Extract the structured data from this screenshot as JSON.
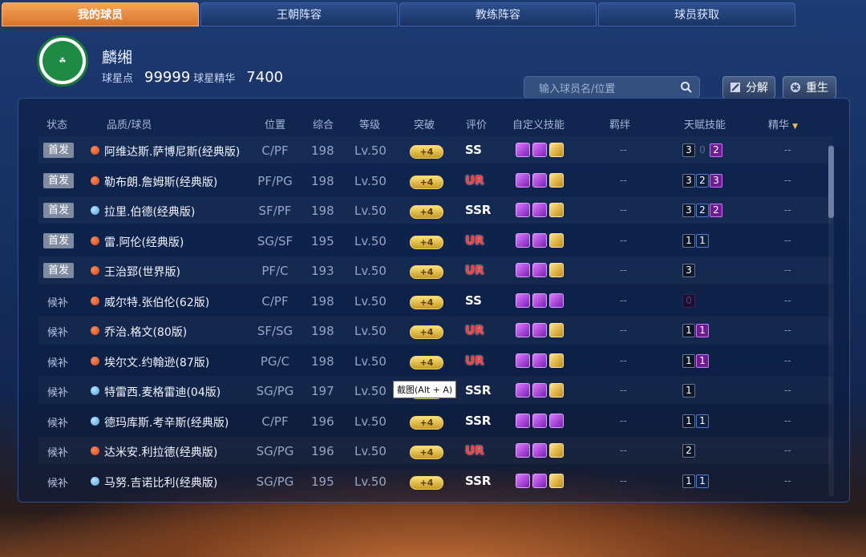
{
  "tabs": [
    {
      "label": "我的球员",
      "active": true
    },
    {
      "label": "王朝阵容",
      "active": false
    },
    {
      "label": "教练阵容",
      "active": false
    },
    {
      "label": "球员获取",
      "active": false
    }
  ],
  "team": {
    "name": "麟缃",
    "points_label": "球星点",
    "points_value": "99999",
    "essence_label": "球星精华",
    "essence_value": "7400",
    "logo_text": "BOSTON CELTICS"
  },
  "search": {
    "placeholder": "输入球员名/位置"
  },
  "toolbar": {
    "decompose_label": "分解",
    "rebirth_label": "重生"
  },
  "columns": [
    "状态",
    "品质/球员",
    "位置",
    "综合",
    "等级",
    "突破",
    "评价",
    "自定义技能",
    "羁绊",
    "天赋技能",
    "精华"
  ],
  "breakthrough_label": "+4",
  "empty_value": "--",
  "players": [
    {
      "status": "首发",
      "starter": true,
      "quality": "red",
      "name": "阿维达斯.萨博尼斯(经典版)",
      "position": "C/PF",
      "overall": "198",
      "level": "Lv.50",
      "rating": "SS",
      "skills": [
        "p",
        "p",
        "g"
      ],
      "talents": [
        [
          "3",
          "k"
        ],
        [
          "0",
          "n"
        ],
        [
          "2",
          "p"
        ]
      ]
    },
    {
      "status": "首发",
      "starter": true,
      "quality": "red",
      "name": "勒布朗.詹姆斯(经典版)",
      "position": "PF/PG",
      "overall": "198",
      "level": "Lv.50",
      "rating": "UR",
      "skills": [
        "p",
        "p",
        "g"
      ],
      "talents": [
        [
          "3",
          "k"
        ],
        [
          "2",
          "b"
        ],
        [
          "3",
          "p"
        ]
      ]
    },
    {
      "status": "首发",
      "starter": true,
      "quality": "blue",
      "name": "拉里.伯德(经典版)",
      "position": "SF/PF",
      "overall": "198",
      "level": "Lv.50",
      "rating": "SSR",
      "skills": [
        "p",
        "p",
        "g"
      ],
      "talents": [
        [
          "3",
          "k"
        ],
        [
          "2",
          "b"
        ],
        [
          "2",
          "p"
        ]
      ]
    },
    {
      "status": "首发",
      "starter": true,
      "quality": "red",
      "name": "雷.阿伦(经典版)",
      "position": "SG/SF",
      "overall": "195",
      "level": "Lv.50",
      "rating": "UR",
      "skills": [
        "p",
        "p",
        "g"
      ],
      "talents": [
        [
          "1",
          "k"
        ],
        [
          "1",
          "b"
        ]
      ]
    },
    {
      "status": "首发",
      "starter": true,
      "quality": "red",
      "name": "王治郅(世界版)",
      "position": "PF/C",
      "overall": "193",
      "level": "Lv.50",
      "rating": "UR",
      "skills": [
        "p",
        "p",
        "g"
      ],
      "talents": [
        [
          "3",
          "k"
        ]
      ]
    },
    {
      "status": "候补",
      "starter": false,
      "quality": "red",
      "name": "威尔特.张伯伦(62版)",
      "position": "C/PF",
      "overall": "198",
      "level": "Lv.50",
      "rating": "SS",
      "skills": [
        "p",
        "p",
        "p"
      ],
      "talents": [
        [
          "0",
          "z"
        ]
      ]
    },
    {
      "status": "候补",
      "starter": false,
      "quality": "red",
      "name": "乔治.格文(80版)",
      "position": "SF/SG",
      "overall": "198",
      "level": "Lv.50",
      "rating": "UR",
      "skills": [
        "p",
        "p",
        "g"
      ],
      "talents": [
        [
          "1",
          "k"
        ],
        [
          "1",
          "p"
        ]
      ]
    },
    {
      "status": "候补",
      "starter": false,
      "quality": "red",
      "name": "埃尔文.约翰逊(87版)",
      "position": "PG/C",
      "overall": "198",
      "level": "Lv.50",
      "rating": "UR",
      "skills": [
        "p",
        "p",
        "g"
      ],
      "talents": [
        [
          "1",
          "k"
        ],
        [
          "1",
          "p"
        ]
      ]
    },
    {
      "status": "候补",
      "starter": false,
      "quality": "blue",
      "name": "特雷西.麦格雷迪(04版)",
      "position": "SG/PG",
      "overall": "197",
      "level": "Lv.50",
      "rating": "SSR",
      "skills": [
        "p",
        "p",
        "g"
      ],
      "talents": [
        [
          "1",
          "k"
        ]
      ]
    },
    {
      "status": "候补",
      "starter": false,
      "quality": "blue",
      "name": "德玛库斯.考辛斯(经典版)",
      "position": "C/PF",
      "overall": "196",
      "level": "Lv.50",
      "rating": "SSR",
      "skills": [
        "p",
        "p",
        "p"
      ],
      "talents": [
        [
          "1",
          "k"
        ],
        [
          "1",
          "b"
        ]
      ]
    },
    {
      "status": "候补",
      "starter": false,
      "quality": "red",
      "name": "达米安.利拉德(经典版)",
      "position": "SG/PG",
      "overall": "196",
      "level": "Lv.50",
      "rating": "UR",
      "skills": [
        "p",
        "p",
        "g"
      ],
      "talents": [
        [
          "2",
          "k"
        ]
      ]
    },
    {
      "status": "候补",
      "starter": false,
      "quality": "blue",
      "name": "马努.吉诺比利(经典版)",
      "position": "SG/PG",
      "overall": "195",
      "level": "Lv.50",
      "rating": "SSR",
      "skills": [
        "p",
        "p",
        "g"
      ],
      "talents": [
        [
          "1",
          "k"
        ],
        [
          "1",
          "b"
        ]
      ]
    }
  ],
  "tooltip": "截图(Alt + A)",
  "sort_indicator": "▼"
}
